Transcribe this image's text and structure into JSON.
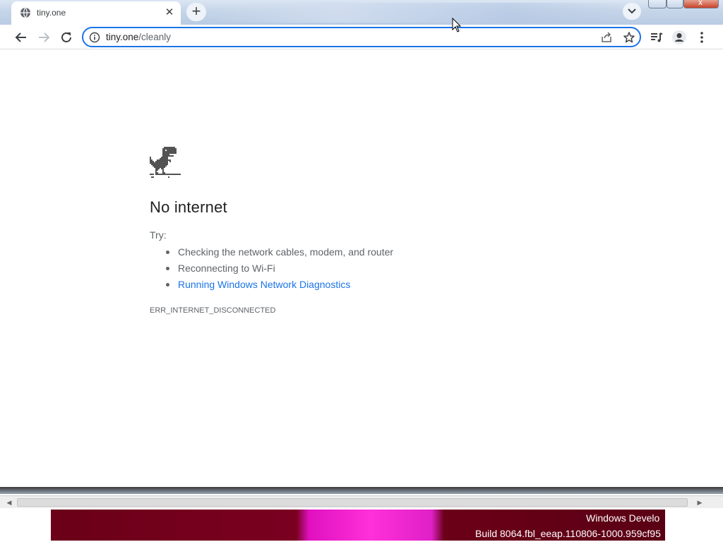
{
  "browser": {
    "tab": {
      "title": "tiny.one"
    },
    "omnibox": {
      "domain": "tiny.one",
      "path": "/cleanly"
    }
  },
  "page": {
    "heading": "No internet",
    "try_label": "Try:",
    "suggestions": [
      "Checking the network cables, modem, and router",
      "Reconnecting to Wi-Fi",
      "Running Windows Network Diagnostics"
    ],
    "error_code": "ERR_INTERNET_DISCONNECTED"
  },
  "desktop": {
    "watermark_line1": "Windows Develo",
    "watermark_line2": "Build 8064.fbl_eeap.110806-1000.959cf95"
  },
  "colors": {
    "accent": "#1a73e8",
    "text": "#202124",
    "secondary_text": "#5f6368",
    "link": "#1a73e8"
  },
  "icons": {
    "tab_favicon": "globe-icon",
    "tab_close": "close-icon",
    "new_tab": "plus-icon",
    "tab_search": "chevron-down-icon",
    "back": "arrow-left-icon",
    "forward": "arrow-right-icon",
    "reload": "reload-icon",
    "site_info": "info-icon",
    "share": "share-icon",
    "bookmark": "star-icon",
    "reading_list": "reading-list-icon",
    "profile": "person-icon",
    "menu": "kebab-menu-icon",
    "error_illustration": "dino-icon"
  }
}
